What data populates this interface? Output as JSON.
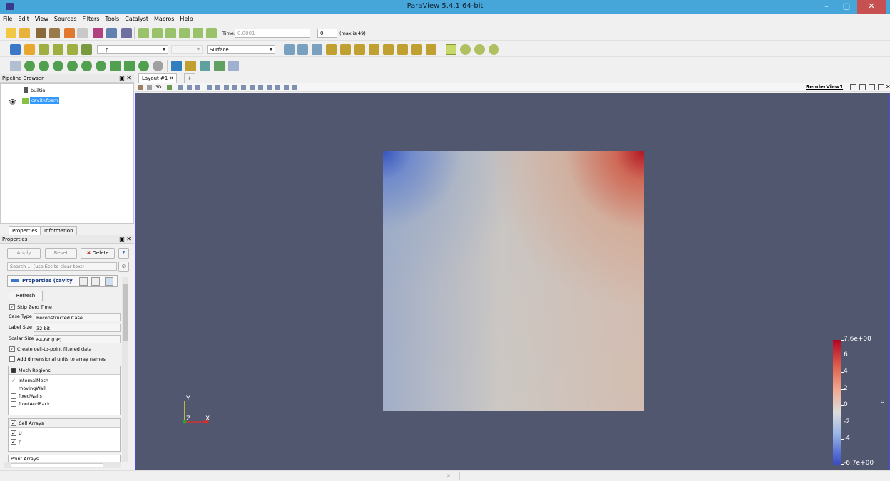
{
  "window": {
    "title": "ParaView 5.4.1 64-bit",
    "min_label": "–",
    "max_label": "▢",
    "close_label": "✕"
  },
  "menu": [
    "File",
    "Edit",
    "View",
    "Sources",
    "Filters",
    "Tools",
    "Catalyst",
    "Macros",
    "Help"
  ],
  "toolbar1": {
    "time_label": "Time:",
    "time_value": "0.0001",
    "timestep_value": "0",
    "max_label": "(max is 49)"
  },
  "toolbar2": {
    "color_by_value": "p",
    "representation_value": "Surface"
  },
  "pipeline": {
    "header": "Pipeline Browser",
    "items": [
      {
        "label": "builtin:"
      },
      {
        "label": "cavity.foam",
        "selected": true
      }
    ]
  },
  "props": {
    "tabs": [
      "Properties",
      "Information"
    ],
    "header": "Properties",
    "apply_label": "Apply",
    "reset_label": "Reset",
    "delete_label": "Delete",
    "help_label": "?",
    "search_placeholder": "Search ... (use Esc to clear text)",
    "section_title": "Properties (cavity",
    "refresh_label": "Refresh",
    "skip_zero_time": "Skip Zero Time",
    "case_type_label": "Case Type",
    "case_type_value": "Reconstructed Case",
    "label_size_label": "Label Size",
    "label_size_value": "32-bit",
    "scalar_size_label": "Scalar Size",
    "scalar_size_value": "64-bit (DP)",
    "cell_to_point": "Create cell-to-point filtered data",
    "dim_units": "Add dimensional units to array names",
    "mesh_regions_header": "Mesh Regions",
    "mesh_regions": [
      {
        "label": "internalMesh",
        "checked": true
      },
      {
        "label": "movingWall",
        "checked": false
      },
      {
        "label": "fixedWalls",
        "checked": false
      },
      {
        "label": "frontAndBack",
        "checked": false
      }
    ],
    "cell_arrays_header": "Cell Arrays",
    "cell_arrays": [
      {
        "label": "U",
        "checked": true
      },
      {
        "label": "p",
        "checked": true
      }
    ],
    "point_arrays_header": "Point Arrays"
  },
  "layout": {
    "tab_label": "Layout #1",
    "tab_close": "✕",
    "add_tab": "+",
    "view_name": "RenderView1",
    "view_3d": "3D"
  },
  "axes": {
    "y": "Y",
    "z": "Z",
    "x": "X"
  },
  "colorbar": {
    "title": "p",
    "labels": [
      "7.6e+00",
      "6",
      "4",
      "2",
      "0",
      "-2",
      "-4",
      "-6.7e+00"
    ],
    "max": 7.6,
    "min": -6.7
  },
  "colors": {
    "accent": "#46a6d9",
    "viewport_bg": "#525770",
    "selection": "#3399ff"
  }
}
